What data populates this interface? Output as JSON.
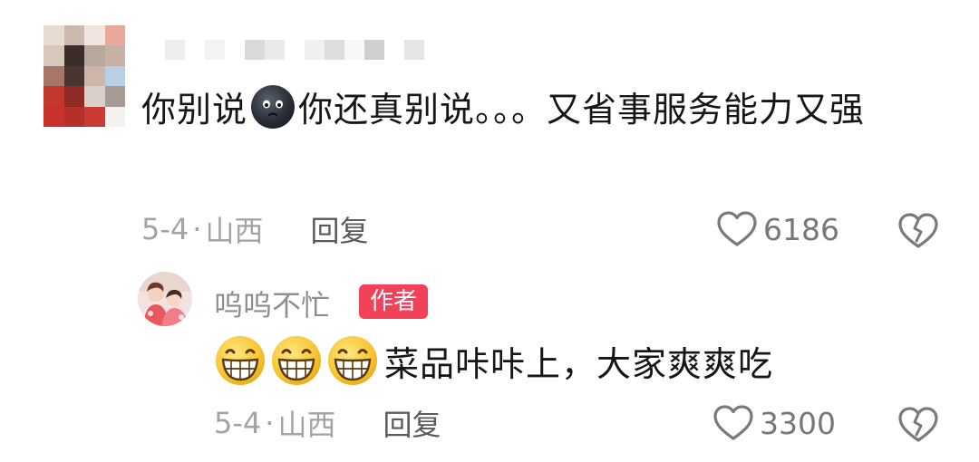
{
  "comment": {
    "avatar": "pixelated-avatar",
    "username": "",
    "text_part1": "你别说",
    "inline_emoji": "dark-face-emoji",
    "text_part2": "你还真别说。。。又省事服务能力又强",
    "date": "5-4",
    "separator": "·",
    "location": "山西",
    "reply_label": "回复",
    "likes": "6186",
    "like_icon": "heart-outline-icon",
    "dislike_icon": "broken-heart-icon"
  },
  "reply": {
    "avatar": "girl-photo-avatar",
    "author_name": "呜呜不忙",
    "author_badge": "作者",
    "badge_color": "#f2425a",
    "emojis": [
      "grin-emoji",
      "grin-emoji",
      "grin-emoji"
    ],
    "text": "菜品咔咔上，大家爽爽吃",
    "date": "5-4",
    "separator": "·",
    "location": "山西",
    "reply_label": "回复",
    "likes": "3300",
    "like_icon": "heart-outline-icon",
    "dislike_icon": "broken-heart-icon"
  }
}
